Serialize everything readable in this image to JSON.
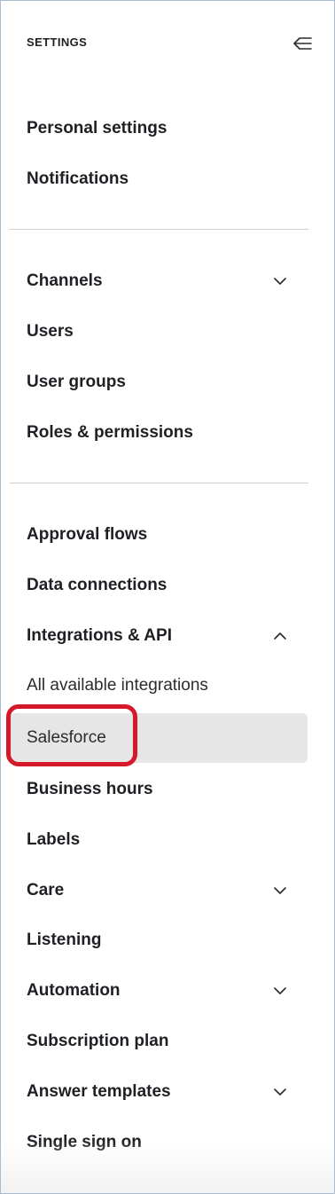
{
  "header": {
    "title": "SETTINGS"
  },
  "icons": {
    "collapse": "collapse-sidebar-icon",
    "chevron_down": "chevron-down-icon",
    "chevron_up": "chevron-up-icon"
  },
  "colors": {
    "selected_bg": "#e6e6e6",
    "highlight": "#d5192b",
    "text": "#1f1f24",
    "divider": "#cfcfcf",
    "frame_border": "#a8bdd4"
  },
  "menu": {
    "personal_settings": "Personal settings",
    "notifications": "Notifications",
    "channels": "Channels",
    "users": "Users",
    "user_groups": "User groups",
    "roles_permissions": "Roles & permissions",
    "approval_flows": "Approval flows",
    "data_connections": "Data connections",
    "integrations_api": "Integrations & API",
    "all_available_integrations": "All available integrations",
    "salesforce": "Salesforce",
    "business_hours": "Business hours",
    "labels": "Labels",
    "care": "Care",
    "listening": "Listening",
    "automation": "Automation",
    "subscription_plan": "Subscription plan",
    "answer_templates": "Answer templates",
    "single_sign_on": "Single sign on"
  }
}
